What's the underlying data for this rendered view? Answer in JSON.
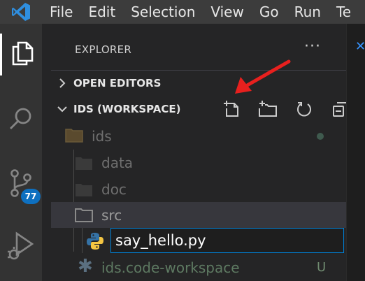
{
  "menu": {
    "items": [
      "File",
      "Edit",
      "Selection",
      "View",
      "Go",
      "Run",
      "Te"
    ]
  },
  "activity_bar": {
    "items": [
      {
        "name": "explorer",
        "icon": "files-icon",
        "active": true
      },
      {
        "name": "search",
        "icon": "search-icon"
      },
      {
        "name": "source-control",
        "icon": "source-control-icon",
        "badge": "77"
      },
      {
        "name": "run-debug",
        "icon": "run-debug-icon"
      }
    ]
  },
  "sidebar": {
    "title": "EXPLORER",
    "more": "···",
    "open_editors": "OPEN EDITORS",
    "workspace": "IDS (WORKSPACE)",
    "workspace_actions": [
      "new-file-icon",
      "new-folder-icon",
      "refresh-icon",
      "collapse-all-icon"
    ]
  },
  "tree": {
    "root": "ids",
    "folders": [
      "data",
      "doc",
      "src"
    ],
    "new_file_value": "say_hello.py",
    "workspace_file": "ids.code-workspace",
    "workspace_file_status": "U"
  },
  "colors": {
    "accent": "#007fd4",
    "badge": "#0e70c0",
    "arrow": "#e8201e",
    "python_blue": "#3572a5",
    "python_yellow": "#f4c542"
  }
}
